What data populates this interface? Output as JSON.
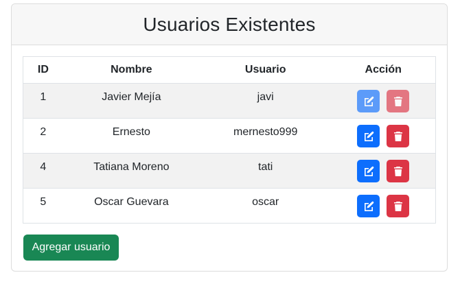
{
  "page": {
    "title": "Usuarios Existentes"
  },
  "table": {
    "headers": {
      "id": "ID",
      "nombre": "Nombre",
      "usuario": "Usuario",
      "accion": "Acción"
    },
    "rows": [
      {
        "id": "1",
        "nombre": "Javier Mejía",
        "usuario": "javi"
      },
      {
        "id": "2",
        "nombre": "Ernesto",
        "usuario": "mernesto999"
      },
      {
        "id": "4",
        "nombre": "Tatiana Moreno",
        "usuario": "tati"
      },
      {
        "id": "5",
        "nombre": "Oscar Guevara",
        "usuario": "oscar"
      }
    ],
    "row_actions": {
      "edit_icon": "edit-icon",
      "delete_icon": "trash-icon"
    }
  },
  "actions": {
    "add_user_label": "Agregar usuario"
  },
  "colors": {
    "edit": "#0d6efd",
    "delete": "#dc3545",
    "add": "#198754",
    "stripe": "#f2f2f2"
  }
}
